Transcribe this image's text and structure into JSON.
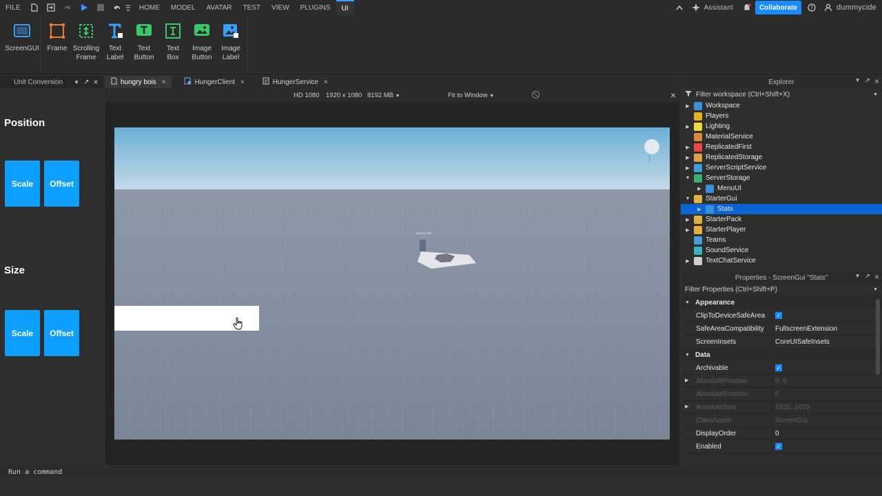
{
  "menubar": {
    "file": "FILE",
    "tabs": [
      "HOME",
      "MODEL",
      "AVATAR",
      "TEST",
      "VIEW",
      "PLUGINS",
      "UI"
    ],
    "assistant": "Assistant",
    "collaborate": "Collaborate",
    "username": "dummycide"
  },
  "ribbon": {
    "tools": [
      {
        "label1": "ScreenGUI",
        "label2": "",
        "icon": "screengui-icon",
        "color": "#3aa0ff"
      },
      {
        "label1": "Frame",
        "label2": "",
        "icon": "frame-icon",
        "color": "#f07a2e"
      },
      {
        "label1": "Scrolling",
        "label2": "Frame",
        "icon": "scrolling-frame-icon",
        "color": "#39c86a"
      },
      {
        "label1": "Text",
        "label2": "Label",
        "icon": "text-label-icon",
        "color": "#3aa0ff"
      },
      {
        "label1": "Text",
        "label2": "Button",
        "icon": "text-button-icon",
        "color": "#39c86a"
      },
      {
        "label1": "Text",
        "label2": "Box",
        "icon": "text-box-icon",
        "color": "#39c86a"
      },
      {
        "label1": "Image",
        "label2": "Button",
        "icon": "image-button-icon",
        "color": "#39c86a"
      },
      {
        "label1": "Image",
        "label2": "Label",
        "icon": "image-label-icon",
        "color": "#3aa0ff"
      }
    ]
  },
  "left_panel": {
    "tab_title": "Unit Conversion",
    "position_heading": "Position",
    "size_heading": "Size",
    "scale_label": "Scale",
    "offset_label": "Offset"
  },
  "doc_tabs": [
    {
      "label": "hungry bois",
      "active": true
    },
    {
      "label": "HungerClient",
      "active": false
    },
    {
      "label": "HungerService",
      "active": false
    }
  ],
  "viewport_toolbar": {
    "device": "HD 1080",
    "resolution": "1920 x 1080",
    "memory": "8192 MB",
    "fit": "Fit to Window"
  },
  "viewport": {
    "player_tag": "dummycide"
  },
  "explorer": {
    "title": "Explorer",
    "filter": "Filter workspace (Ctrl+Shift+X)",
    "items": [
      {
        "name": "Workspace",
        "indent": 0,
        "arrow": "▶",
        "icon_color": "#3a8fd9",
        "selected": false
      },
      {
        "name": "Players",
        "indent": 0,
        "arrow": "",
        "icon_color": "#e0b020",
        "selected": false
      },
      {
        "name": "Lighting",
        "indent": 0,
        "arrow": "▶",
        "icon_color": "#f5d742",
        "selected": false
      },
      {
        "name": "MaterialService",
        "indent": 0,
        "arrow": "",
        "icon_color": "#d88a3a",
        "selected": false
      },
      {
        "name": "ReplicatedFirst",
        "indent": 0,
        "arrow": "▶",
        "icon_color": "#e84a4a",
        "selected": false
      },
      {
        "name": "ReplicatedStorage",
        "indent": 0,
        "arrow": "▶",
        "icon_color": "#e0a04a",
        "selected": false
      },
      {
        "name": "ServerScriptService",
        "indent": 0,
        "arrow": "▶",
        "icon_color": "#3aa0d0",
        "selected": false
      },
      {
        "name": "ServerStorage",
        "indent": 0,
        "arrow": "▼",
        "icon_color": "#3ab070",
        "selected": false
      },
      {
        "name": "MenuUI",
        "indent": 1,
        "arrow": "▶",
        "icon_color": "#3a8fd9",
        "selected": false
      },
      {
        "name": "StarterGui",
        "indent": 0,
        "arrow": "▼",
        "icon_color": "#e0b040",
        "selected": false
      },
      {
        "name": "Stats",
        "indent": 1,
        "arrow": "▶",
        "icon_color": "#3a8fd9",
        "selected": true
      },
      {
        "name": "StarterPack",
        "indent": 0,
        "arrow": "▶",
        "icon_color": "#e0b040",
        "selected": false
      },
      {
        "name": "StarterPlayer",
        "indent": 0,
        "arrow": "▶",
        "icon_color": "#e0b040",
        "selected": false
      },
      {
        "name": "Teams",
        "indent": 0,
        "arrow": "",
        "icon_color": "#4a9ad9",
        "selected": false
      },
      {
        "name": "SoundService",
        "indent": 0,
        "arrow": "",
        "icon_color": "#3ab0c0",
        "selected": false
      },
      {
        "name": "TextChatService",
        "indent": 0,
        "arrow": "▶",
        "icon_color": "#cfcfcf",
        "selected": false
      }
    ]
  },
  "properties": {
    "title": "Properties - ScreenGui \"Stats\"",
    "filter": "Filter Properties (Ctrl+Shift+P)",
    "sections": [
      {
        "name": "Appearance",
        "rows": [
          {
            "name": "ClipToDeviceSafeArea",
            "value": "",
            "checkbox": true,
            "dim": false,
            "arrow": false
          },
          {
            "name": "SafeAreaCompatibility",
            "value": "FullscreenExtension",
            "checkbox": false,
            "dim": false,
            "arrow": false
          },
          {
            "name": "ScreenInsets",
            "value": "CoreUISafeInsets",
            "checkbox": false,
            "dim": false,
            "arrow": false
          }
        ]
      },
      {
        "name": "Data",
        "rows": [
          {
            "name": "Archivable",
            "value": "",
            "checkbox": true,
            "dim": false,
            "arrow": false
          },
          {
            "name": "AbsolutePosition",
            "value": "0, 0",
            "checkbox": false,
            "dim": true,
            "arrow": true
          },
          {
            "name": "AbsoluteRotation",
            "value": "0",
            "checkbox": false,
            "dim": true,
            "arrow": false
          },
          {
            "name": "AbsoluteSize",
            "value": "1920, 1079",
            "checkbox": false,
            "dim": true,
            "arrow": true
          },
          {
            "name": "ClassName",
            "value": "ScreenGui",
            "checkbox": false,
            "dim": true,
            "arrow": false
          },
          {
            "name": "DisplayOrder",
            "value": "0",
            "checkbox": false,
            "dim": false,
            "arrow": false
          },
          {
            "name": "Enabled",
            "value": "",
            "checkbox": true,
            "dim": false,
            "arrow": false
          }
        ]
      }
    ]
  },
  "command_bar": {
    "placeholder": "Run a command"
  }
}
